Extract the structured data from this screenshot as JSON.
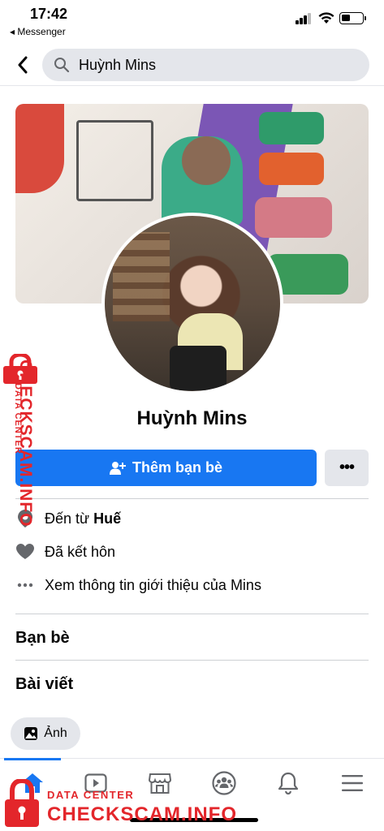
{
  "status_bar": {
    "time": "17:42",
    "back_app": "◂ Messenger"
  },
  "nav": {
    "search_query": "Huỳnh Mins"
  },
  "profile": {
    "name": "Huỳnh Mins",
    "add_friend_label": "Thêm bạn bè",
    "more_label": "•••"
  },
  "intro": {
    "hometown_prefix": "Đến từ",
    "hometown_city": "Huế",
    "relationship": "Đã kết hôn",
    "see_about": "Xem thông tin giới thiệu của Mins"
  },
  "sections": {
    "friends": "Bạn bè",
    "posts": "Bài viết",
    "photos_chip": "Ảnh"
  },
  "tabs": [
    "home-icon",
    "video-icon",
    "marketplace-icon",
    "groups-icon",
    "notifications-icon",
    "menu-icon"
  ],
  "watermark": {
    "small": "DATA CENTER",
    "big": "CHECKSCAM.INFO"
  },
  "colors": {
    "accent": "#1877f2",
    "watermark": "#e3262b",
    "chip_bg": "#e4e6eb"
  }
}
